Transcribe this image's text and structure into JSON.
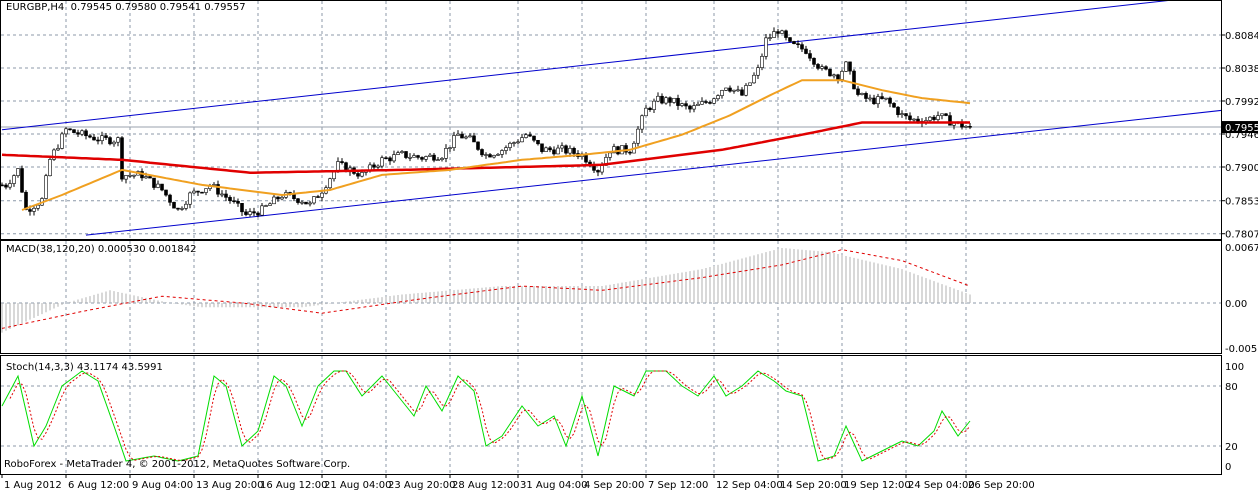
{
  "header": {
    "symbol": "EURGBP,H4",
    "ohlc": "0.79545 0.79580 0.79541 0.79557"
  },
  "macd_label": "MACD(38,120,20) 0.000530 0.001842",
  "stoch_label": "Stoch(14,3,3) 43.1174 43.5991",
  "copyright": "RoboForex - MetaTrader 4, © 2001-2012, MetaQuotes Software Corp.",
  "colors": {
    "grid": "#8c98a8",
    "channel": "#0000cc",
    "ma_fast": "#f0a020",
    "ma_slow": "#e00000",
    "macd_hist": "#b0b0b0",
    "stoch_main": "#00dd00",
    "stoch_signal": "#e00000"
  },
  "chart_data": [
    {
      "type": "candlestick",
      "title": "EURGBP,H4",
      "price_axis_labels": [
        "0.80840",
        "0.80380",
        "0.79920",
        "0.79460",
        "0.79000",
        "0.78530",
        "0.78070"
      ],
      "price_axis_values": [
        0.8084,
        0.8038,
        0.7992,
        0.7946,
        0.79,
        0.7853,
        0.7807
      ],
      "current_price": "0.79557",
      "ylim": [
        0.7802,
        0.8127
      ],
      "time_labels": [
        "1 Aug 2012",
        "6 Aug 12:00",
        "9 Aug 04:00",
        "13 Aug 20:00",
        "16 Aug 12:00",
        "21 Aug 04:00",
        "23 Aug 20:00",
        "28 Aug 12:00",
        "31 Aug 04:00",
        "4 Sep 20:00",
        "7 Sep 12:00",
        "12 Sep 04:00",
        "14 Sep 20:00",
        "19 Sep 12:00",
        "24 Sep 04:00",
        "26 Sep 20:00"
      ],
      "time_label_bars": [
        0,
        16,
        32,
        48,
        64,
        80,
        96,
        112,
        129,
        145,
        161,
        178,
        194,
        210,
        226,
        241
      ],
      "close_keypoints": [
        [
          1,
          0.7875
        ],
        [
          4,
          0.7896
        ],
        [
          6,
          0.784
        ],
        [
          10,
          0.7854
        ],
        [
          12,
          0.791
        ],
        [
          16,
          0.7952
        ],
        [
          20,
          0.7945
        ],
        [
          25,
          0.7938
        ],
        [
          29,
          0.7938
        ],
        [
          30,
          0.7889
        ],
        [
          35,
          0.7889
        ],
        [
          40,
          0.7868
        ],
        [
          44,
          0.784
        ],
        [
          47,
          0.7861
        ],
        [
          52,
          0.7875
        ],
        [
          57,
          0.7854
        ],
        [
          61,
          0.7833
        ],
        [
          65,
          0.784
        ],
        [
          70,
          0.7861
        ],
        [
          75,
          0.7854
        ],
        [
          77,
          0.7847
        ],
        [
          80,
          0.7868
        ],
        [
          84,
          0.7903
        ],
        [
          90,
          0.7889
        ],
        [
          95,
          0.791
        ],
        [
          100,
          0.7917
        ],
        [
          105,
          0.7913
        ],
        [
          110,
          0.7917
        ],
        [
          114,
          0.7945
        ],
        [
          117,
          0.7938
        ],
        [
          121,
          0.7917
        ],
        [
          125,
          0.7924
        ],
        [
          131,
          0.7945
        ],
        [
          135,
          0.7924
        ],
        [
          140,
          0.7924
        ],
        [
          145,
          0.7917
        ],
        [
          149,
          0.7896
        ],
        [
          152,
          0.7924
        ],
        [
          157,
          0.7924
        ],
        [
          161,
          0.798
        ],
        [
          164,
          0.7993
        ],
        [
          167,
          0.7993
        ],
        [
          172,
          0.798
        ],
        [
          177,
          0.7993
        ],
        [
          181,
          0.8014
        ],
        [
          185,
          0.8
        ],
        [
          189,
          0.8035
        ],
        [
          191,
          0.8077
        ],
        [
          194,
          0.8091
        ],
        [
          197,
          0.807
        ],
        [
          201,
          0.8063
        ],
        [
          205,
          0.8035
        ],
        [
          209,
          0.8028
        ],
        [
          211,
          0.8042
        ],
        [
          214,
          0.8
        ],
        [
          217,
          0.7993
        ],
        [
          221,
          0.7993
        ],
        [
          225,
          0.7972
        ],
        [
          227,
          0.7966
        ],
        [
          231,
          0.7966
        ],
        [
          234,
          0.7972
        ],
        [
          236,
          0.7966
        ],
        [
          240,
          0.7958
        ],
        [
          242,
          0.79557
        ]
      ],
      "ma_fast_keypoints": [
        [
          5,
          0.784
        ],
        [
          15,
          0.7861
        ],
        [
          30,
          0.7896
        ],
        [
          50,
          0.7875
        ],
        [
          70,
          0.7861
        ],
        [
          82,
          0.7868
        ],
        [
          95,
          0.7889
        ],
        [
          112,
          0.7896
        ],
        [
          130,
          0.791
        ],
        [
          145,
          0.7917
        ],
        [
          157,
          0.7924
        ],
        [
          170,
          0.7945
        ],
        [
          182,
          0.7972
        ],
        [
          192,
          0.8
        ],
        [
          200,
          0.8021
        ],
        [
          210,
          0.8021
        ],
        [
          220,
          0.8007
        ],
        [
          230,
          0.7996
        ],
        [
          242,
          0.7989
        ]
      ],
      "ma_slow_keypoints": [
        [
          0,
          0.7917
        ],
        [
          30,
          0.791
        ],
        [
          62,
          0.7892
        ],
        [
          100,
          0.7896
        ],
        [
          150,
          0.7903
        ],
        [
          180,
          0.7924
        ],
        [
          200,
          0.7945
        ],
        [
          215,
          0.7962
        ],
        [
          242,
          0.7962
        ]
      ],
      "channel_upper": [
        [
          0,
          0.7952
        ],
        [
          293,
          0.8133
        ]
      ],
      "channel_lower": [
        [
          21,
          0.7805
        ],
        [
          305,
          0.7979
        ]
      ]
    },
    {
      "type": "bar+line",
      "title": "MACD(38,120,20)",
      "axis_labels": [
        "0.006735",
        "0.00",
        "-0.005375"
      ],
      "axis_values": [
        0.006735,
        0,
        -0.005375
      ],
      "histogram_keypoints": [
        [
          0,
          -0.0035
        ],
        [
          16,
          0
        ],
        [
          27,
          0.0015
        ],
        [
          42,
          0
        ],
        [
          50,
          -0.0005
        ],
        [
          75,
          -0.0005
        ],
        [
          100,
          0.001
        ],
        [
          125,
          0.002
        ],
        [
          150,
          0.002
        ],
        [
          175,
          0.004
        ],
        [
          195,
          0.0065
        ],
        [
          207,
          0.006
        ],
        [
          225,
          0.004
        ],
        [
          242,
          0.001
        ]
      ],
      "signal_keypoints": [
        [
          0,
          -0.003
        ],
        [
          20,
          -0.001
        ],
        [
          40,
          0.0008
        ],
        [
          60,
          0
        ],
        [
          80,
          -0.0012
        ],
        [
          105,
          0.0005
        ],
        [
          130,
          0.002
        ],
        [
          150,
          0.0015
        ],
        [
          175,
          0.003
        ],
        [
          195,
          0.0045
        ],
        [
          210,
          0.0063
        ],
        [
          225,
          0.005
        ],
        [
          242,
          0.002
        ]
      ]
    },
    {
      "type": "line",
      "title": "Stoch(14,3,3)",
      "axis_labels": [
        "100",
        "80",
        "20",
        "0"
      ],
      "axis_values": [
        100,
        80,
        20,
        0
      ],
      "main_keypoints": [
        [
          0,
          60
        ],
        [
          4,
          90
        ],
        [
          8,
          20
        ],
        [
          11,
          40
        ],
        [
          15,
          80
        ],
        [
          20,
          95
        ],
        [
          24,
          85
        ],
        [
          28,
          40
        ],
        [
          31,
          5
        ],
        [
          38,
          10
        ],
        [
          44,
          5
        ],
        [
          49,
          10
        ],
        [
          53,
          90
        ],
        [
          56,
          80
        ],
        [
          60,
          20
        ],
        [
          64,
          35
        ],
        [
          68,
          90
        ],
        [
          71,
          80
        ],
        [
          75,
          40
        ],
        [
          79,
          80
        ],
        [
          83,
          95
        ],
        [
          86,
          95
        ],
        [
          90,
          70
        ],
        [
          95,
          90
        ],
        [
          99,
          70
        ],
        [
          103,
          50
        ],
        [
          106,
          80
        ],
        [
          110,
          55
        ],
        [
          114,
          90
        ],
        [
          118,
          75
        ],
        [
          121,
          20
        ],
        [
          125,
          30
        ],
        [
          130,
          60
        ],
        [
          134,
          40
        ],
        [
          138,
          50
        ],
        [
          141,
          20
        ],
        [
          145,
          70
        ],
        [
          149,
          10
        ],
        [
          153,
          80
        ],
        [
          158,
          70
        ],
        [
          161,
          95
        ],
        [
          166,
          95
        ],
        [
          170,
          80
        ],
        [
          174,
          70
        ],
        [
          178,
          90
        ],
        [
          181,
          70
        ],
        [
          185,
          80
        ],
        [
          189,
          95
        ],
        [
          193,
          85
        ],
        [
          196,
          75
        ],
        [
          200,
          70
        ],
        [
          204,
          5
        ],
        [
          208,
          10
        ],
        [
          211,
          40
        ],
        [
          215,
          5
        ],
        [
          220,
          15
        ],
        [
          225,
          25
        ],
        [
          229,
          20
        ],
        [
          233,
          35
        ],
        [
          235,
          55
        ],
        [
          239,
          30
        ],
        [
          242,
          45
        ]
      ]
    }
  ]
}
